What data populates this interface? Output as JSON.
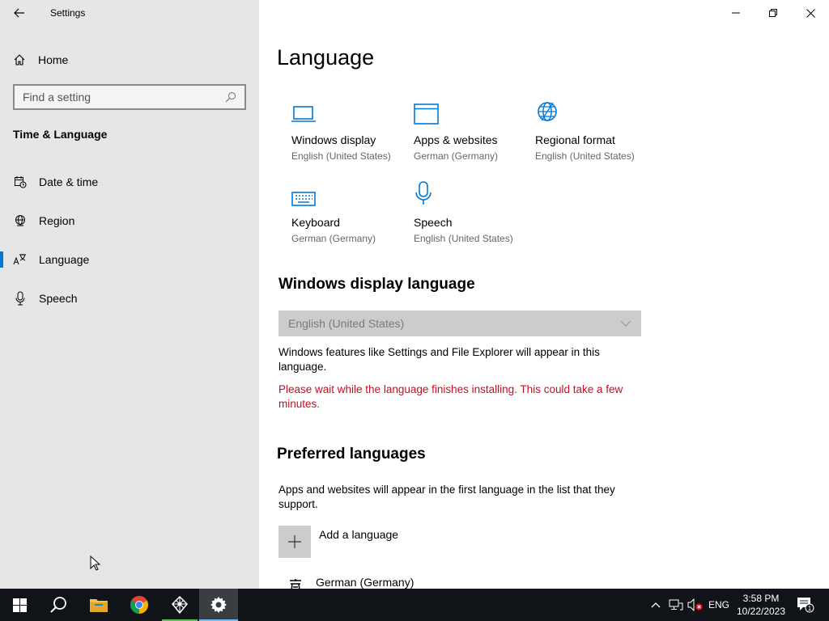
{
  "app": {
    "title": "Settings"
  },
  "sidebar": {
    "home_label": "Home",
    "search_placeholder": "Find a setting",
    "section_title": "Time & Language",
    "items": [
      {
        "label": "Date & time",
        "icon": "calendar-clock-icon"
      },
      {
        "label": "Region",
        "icon": "globe-icon"
      },
      {
        "label": "Language",
        "icon": "language-icon",
        "active": true
      },
      {
        "label": "Speech",
        "icon": "microphone-icon"
      }
    ]
  },
  "main": {
    "title": "Language",
    "tiles": [
      {
        "name": "Windows display",
        "sub": "English (United States)",
        "icon": "monitor-icon"
      },
      {
        "name": "Apps & websites",
        "sub": "German (Germany)",
        "icon": "window-icon"
      },
      {
        "name": "Regional format",
        "sub": "English (United States)",
        "icon": "globe-grid-icon"
      },
      {
        "name": "Keyboard",
        "sub": "German (Germany)",
        "icon": "keyboard-icon"
      },
      {
        "name": "Speech",
        "sub": "English (United States)",
        "icon": "microphone-icon"
      }
    ],
    "display_language": {
      "heading": "Windows display language",
      "selected": "English (United States)",
      "description": "Windows features like Settings and File Explorer will appear in this language.",
      "warning": "Please wait while the language finishes installing. This could take a few minutes."
    },
    "preferred": {
      "heading": "Preferred languages",
      "description": "Apps and websites will appear in the first language in the list that they support.",
      "add_label": "Add a language",
      "languages": [
        "German (Germany)"
      ]
    }
  },
  "taskbar": {
    "input_indicator": "ENG",
    "time": "3:58 PM",
    "date": "10/22/2023",
    "notification_count": "1"
  },
  "colors": {
    "accent": "#0078d7",
    "warning": "#c50f1f",
    "sidebar_bg": "#e6e6e6",
    "taskbar_bg": "#101418"
  }
}
